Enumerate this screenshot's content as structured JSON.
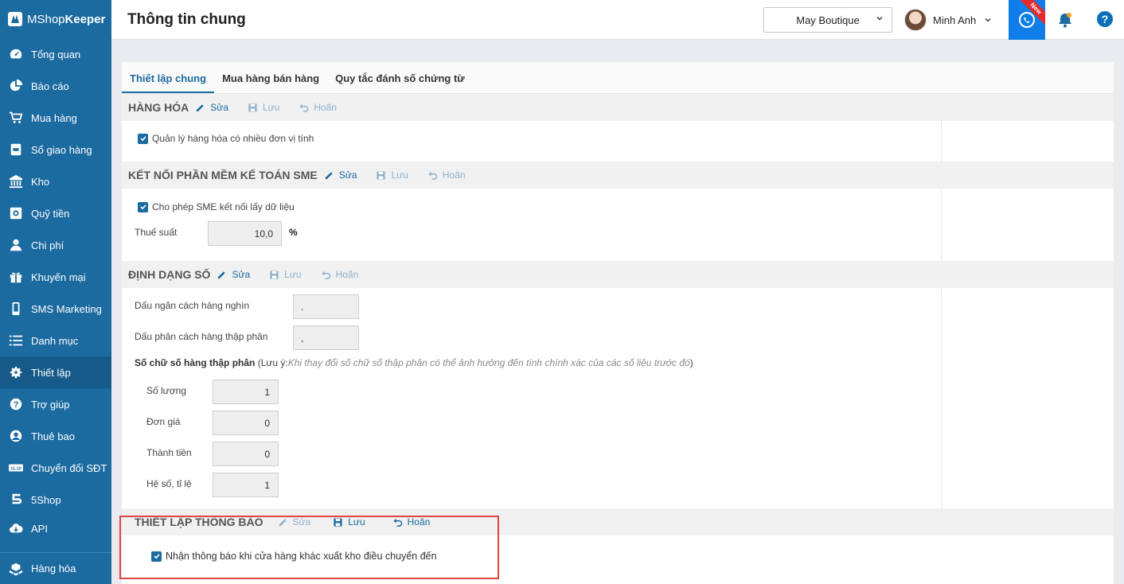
{
  "app": {
    "logo_prefix": "MShop",
    "logo_suffix": "Keeper"
  },
  "sidebar": {
    "items": [
      {
        "label": "Tổng quan",
        "icon": "dashboard-icon"
      },
      {
        "label": "Báo cáo",
        "icon": "pie-chart-icon"
      },
      {
        "label": "Mua hàng",
        "icon": "cart-icon"
      },
      {
        "label": "Sổ giao hàng",
        "icon": "delivery-book-icon"
      },
      {
        "label": "Kho",
        "icon": "warehouse-icon"
      },
      {
        "label": "Quỹ tiền",
        "icon": "safe-icon"
      },
      {
        "label": "Chi phí",
        "icon": "expense-icon"
      },
      {
        "label": "Khuyến mại",
        "icon": "gift-icon"
      },
      {
        "label": "SMS Marketing",
        "icon": "phone-icon"
      },
      {
        "label": "Danh mục",
        "icon": "list-icon"
      },
      {
        "label": "Thiết lập",
        "icon": "gear-icon",
        "active": true
      },
      {
        "label": "Trợ giúp",
        "icon": "help-icon"
      },
      {
        "label": "Thuê bao",
        "icon": "user-icon"
      },
      {
        "label": "Chuyển đổi SĐT",
        "icon": "phone-convert-icon",
        "badge": "11-10"
      },
      {
        "label": "5Shop",
        "icon": "5shop-icon"
      },
      {
        "label": "API",
        "icon": "cloud-icon"
      }
    ],
    "bottom_item": {
      "label": "Hàng hóa",
      "icon": "boxes-icon"
    }
  },
  "header": {
    "title": "Thông tin chung",
    "store": "May Boutique",
    "user_name": "Minh Anh",
    "chat_badge": "New",
    "help_label": "?"
  },
  "tabs": [
    {
      "label": "Thiết lập chung",
      "active": true
    },
    {
      "label": "Mua hàng bán hàng"
    },
    {
      "label": "Quy tắc đánh số chứng từ"
    }
  ],
  "actions": {
    "edit": "Sửa",
    "save": "Lưu",
    "cancel": "Hoãn"
  },
  "sections": {
    "goods": {
      "title": "HÀNG HÓA",
      "checkbox_label": "Quản lý hàng hóa có nhiều đơn vị tính",
      "checked": true
    },
    "sme": {
      "title": "KẾT NỐI PHẦN MỀM KẾ TOÁN SME",
      "checkbox_label": "Cho phép SME kết nối lấy dữ liệu",
      "checked": true,
      "tax_label": "Thuế suất",
      "tax_value": "10,0",
      "tax_unit": "%"
    },
    "number_format": {
      "title": "ĐỊNH DẠNG SỐ",
      "thousand_label": "Dấu ngăn cách hàng nghìn",
      "thousand_value": ".",
      "decimal_label": "Dấu phân cách hàng thập phân",
      "decimal_value": ",",
      "digits_heading": "Số chữ số hàng thập phân",
      "note_prefix": "(Lưu ý: ",
      "note_text": "Khi thay đổi số chữ số thập phân có thể ảnh hưởng đến tính chính xác của các số liệu trước đó",
      "note_suffix": ")",
      "fields": [
        {
          "label": "Số lượng",
          "value": "1"
        },
        {
          "label": "Đơn giá",
          "value": "0"
        },
        {
          "label": "Thành tiền",
          "value": "0"
        },
        {
          "label": "Hệ số, tỉ lệ",
          "value": "1"
        }
      ]
    },
    "notify": {
      "title": "THIẾT LẬP THÔNG BÁO",
      "checkbox_label": "Nhận thông báo khi cửa hàng khác xuất kho điều chuyển đến",
      "checked": true
    }
  },
  "colors": {
    "primary": "#1b6aa0",
    "highlight": "#e04545",
    "chat": "#0f7ee8"
  }
}
